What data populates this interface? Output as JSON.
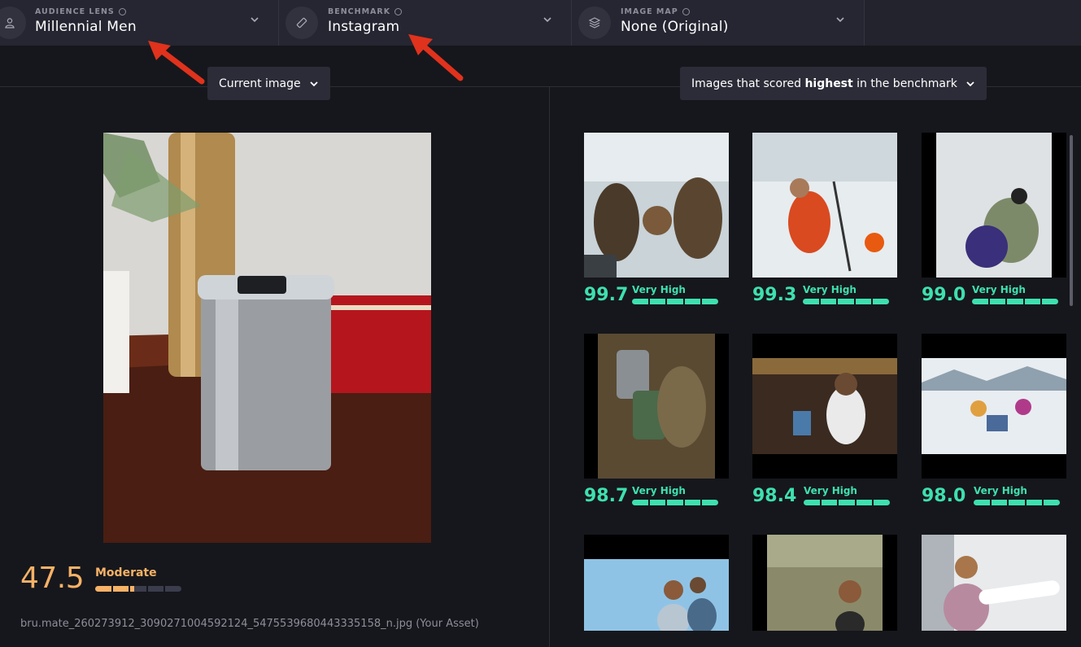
{
  "header": {
    "audience_lens": {
      "label": "AUDIENCE LENS",
      "value": "Millennial Men"
    },
    "benchmark": {
      "label": "BENCHMARK",
      "value": "Instagram"
    },
    "image_map": {
      "label": "IMAGE MAP",
      "value": "None (Original)"
    }
  },
  "left_panel": {
    "dropdown_label": "Current image",
    "score": "47.5",
    "score_label": "Moderate",
    "score_fraction": 0.45,
    "filename": "bru.mate_260273912_3090271004592124_5475539680443335158_n.jpg (Your Asset)"
  },
  "right_panel": {
    "dropdown_prefix": "Images that scored ",
    "dropdown_bold": "highest",
    "dropdown_suffix": " in the benchmark",
    "items": [
      {
        "score": "99.7",
        "label": "Very High",
        "fraction": 1.0
      },
      {
        "score": "99.3",
        "label": "Very High",
        "fraction": 1.0
      },
      {
        "score": "99.0",
        "label": "Very High",
        "fraction": 1.0
      },
      {
        "score": "98.7",
        "label": "Very High",
        "fraction": 1.0
      },
      {
        "score": "98.4",
        "label": "Very High",
        "fraction": 1.0
      },
      {
        "score": "98.0",
        "label": "Very High",
        "fraction": 1.0
      }
    ]
  },
  "colors": {
    "accent_high": "#3ee0b0",
    "accent_moderate": "#f7b267",
    "arrow": "#e0321c"
  },
  "icons": {
    "audience": "person-icon",
    "benchmark": "ruler-icon",
    "image_map": "layers-icon"
  }
}
